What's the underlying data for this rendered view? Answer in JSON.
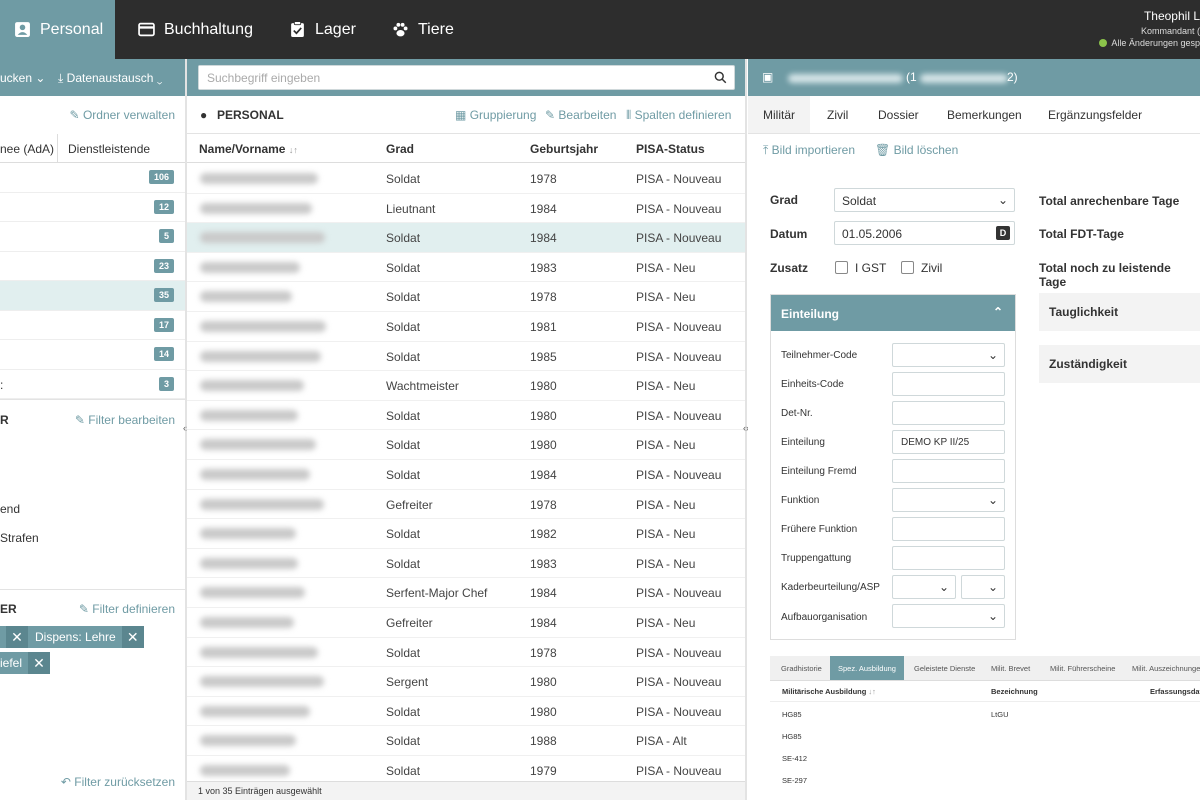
{
  "nav": {
    "items": [
      {
        "label": "Personal",
        "icon": "badge-icon",
        "active": true
      },
      {
        "label": "Buchhaltung",
        "icon": "credit-card-icon"
      },
      {
        "label": "Lager",
        "icon": "clipboard-check-icon"
      },
      {
        "label": "Tiere",
        "icon": "paw-icon"
      }
    ],
    "user": {
      "name": "Theophil L",
      "role": "Kommandant (",
      "status": "Alle Änderungen gesp"
    }
  },
  "left": {
    "toolbar": {
      "print_label": "ucken",
      "exchange_label": "Datenaustausch"
    },
    "manage_folders": "Ordner verwalten",
    "tabs": [
      "nee (AdA)",
      "Dienstleistende"
    ],
    "folders": [
      {
        "label": "",
        "count": "106"
      },
      {
        "label": "",
        "count": "12"
      },
      {
        "label": "",
        "count": "5"
      },
      {
        "label": "",
        "count": "23"
      },
      {
        "label": "",
        "count": "35"
      },
      {
        "label": "",
        "count": "17"
      },
      {
        "label": "",
        "count": "14"
      },
      {
        "label": ":",
        "count": "3"
      }
    ],
    "filter_section": {
      "title": "R",
      "edit_label": "Filter bearbeiten",
      "items": [
        "end",
        "Strafen"
      ]
    },
    "filter2_section": {
      "title": "ER",
      "define_label": "Filter definieren"
    },
    "chips": [
      "",
      "Dispens: Lehre",
      "iefel"
    ],
    "reset_label": "Filter zurücksetzen"
  },
  "middle": {
    "search_placeholder": "Suchbegriff eingeben",
    "title": "PERSONAL",
    "actions": {
      "group": "Gruppierung",
      "edit": "Bearbeiten",
      "columns": "Spalten definieren"
    },
    "columns": {
      "name": "Name/Vorname",
      "grade": "Grad",
      "year": "Geburtsjahr",
      "pisa": "PISA-Status"
    },
    "rows": [
      {
        "grade": "Soldat",
        "year": "1978",
        "pisa": "PISA - Nouveau"
      },
      {
        "grade": "Lieutnant",
        "year": "1984",
        "pisa": "PISA - Nouveau"
      },
      {
        "grade": "Soldat",
        "year": "1984",
        "pisa": "PISA - Nouveau"
      },
      {
        "grade": "Soldat",
        "year": "1983",
        "pisa": "PISA - Neu"
      },
      {
        "grade": "Soldat",
        "year": "1978",
        "pisa": "PISA - Neu"
      },
      {
        "grade": "Soldat",
        "year": "1981",
        "pisa": "PISA - Nouveau"
      },
      {
        "grade": "Soldat",
        "year": "1985",
        "pisa": "PISA - Nouveau"
      },
      {
        "grade": "Wachtmeister",
        "year": "1980",
        "pisa": "PISA - Neu"
      },
      {
        "grade": "Soldat",
        "year": "1980",
        "pisa": "PISA - Nouveau"
      },
      {
        "grade": "Soldat",
        "year": "1980",
        "pisa": "PISA - Neu"
      },
      {
        "grade": "Soldat",
        "year": "1984",
        "pisa": "PISA - Nouveau"
      },
      {
        "grade": "Gefreiter",
        "year": "1978",
        "pisa": "PISA - Neu"
      },
      {
        "grade": "Soldat",
        "year": "1982",
        "pisa": "PISA - Neu"
      },
      {
        "grade": "Soldat",
        "year": "1983",
        "pisa": "PISA - Neu"
      },
      {
        "grade": "Serfent-Major Chef",
        "year": "1984",
        "pisa": "PISA - Nouveau"
      },
      {
        "grade": "Gefreiter",
        "year": "1984",
        "pisa": "PISA - Neu"
      },
      {
        "grade": "Soldat",
        "year": "1978",
        "pisa": "PISA - Nouveau"
      },
      {
        "grade": "Sergent",
        "year": "1980",
        "pisa": "PISA - Nouveau"
      },
      {
        "grade": "Soldat",
        "year": "1980",
        "pisa": "PISA - Nouveau"
      },
      {
        "grade": "Soldat",
        "year": "1988",
        "pisa": "PISA - Alt"
      },
      {
        "grade": "Soldat",
        "year": "1979",
        "pisa": "PISA - Nouveau"
      }
    ],
    "footer": "1 von 35 Einträgen ausgewählt"
  },
  "right": {
    "title_suffix": "(1",
    "title_suffix2": "2)",
    "tabs": [
      "Militär",
      "Zivil",
      "Dossier",
      "Bemerkungen",
      "Ergänzungsfelder"
    ],
    "actions": {
      "import": "Bild importieren",
      "delete": "Bild löschen"
    },
    "form": {
      "grade_label": "Grad",
      "grade_value": "Soldat",
      "date_label": "Datum",
      "date_value": "01.05.2006",
      "extra_label": "Zusatz",
      "extra_opt1": "I GST",
      "extra_opt2": "Zivil"
    },
    "totals": [
      "Total anrechenbare Tage",
      "Total FDT-Tage",
      "Total noch zu leistende Tage"
    ],
    "einteilung": {
      "title": "Einteilung",
      "fields": [
        {
          "label": "Teilnehmer-Code",
          "value": ""
        },
        {
          "label": "Einheits-Code",
          "value": ""
        },
        {
          "label": "Det-Nr.",
          "value": ""
        },
        {
          "label": "Einteilung",
          "value": "DEMO KP II/25"
        },
        {
          "label": "Einteilung Fremd",
          "value": ""
        },
        {
          "label": "Funktion",
          "value": ""
        },
        {
          "label": "Frühere Funktion",
          "value": ""
        },
        {
          "label": "Truppengattung",
          "value": ""
        },
        {
          "label": "Kaderbeurteilung/ASP",
          "value": ""
        },
        {
          "label": "Aufbauorganisation",
          "value": ""
        }
      ]
    },
    "boxes": [
      "Tauglichkeit",
      "Zuständigkeit"
    ],
    "subtabs": [
      "Gradhistorie",
      "Spez. Ausbildung",
      "Geleistete Dienste",
      "Milit. Brevet",
      "Milit. Führerscheine",
      "Milit. Auszeichnunge"
    ],
    "subtable": {
      "columns": [
        "Militärische Ausbildung",
        "Bezeichnung",
        "Erfassungsdat"
      ],
      "rows": [
        {
          "a": "HG85",
          "b": "LtGU"
        },
        {
          "a": "HG85",
          "b": ""
        },
        {
          "a": "SE-412",
          "b": ""
        },
        {
          "a": "SE-297",
          "b": ""
        }
      ]
    }
  },
  "colors": {
    "accent": "#6f9ba4",
    "topbar": "#2d2d2d",
    "selected_row": "#e1efef"
  }
}
